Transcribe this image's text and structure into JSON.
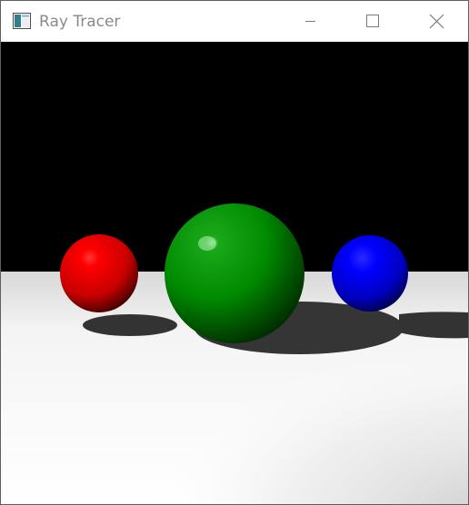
{
  "window": {
    "title": "Ray Tracer",
    "controls": {
      "minimize": "minimize-icon",
      "maximize": "maximize-icon",
      "close": "close-icon"
    }
  },
  "scene": {
    "background_color": "#000000",
    "floor_color": "#ffffff",
    "spheres": [
      {
        "name": "red-sphere",
        "color": "#ff0000"
      },
      {
        "name": "green-sphere",
        "color": "#00a000"
      },
      {
        "name": "blue-sphere",
        "color": "#0000ff"
      }
    ]
  }
}
